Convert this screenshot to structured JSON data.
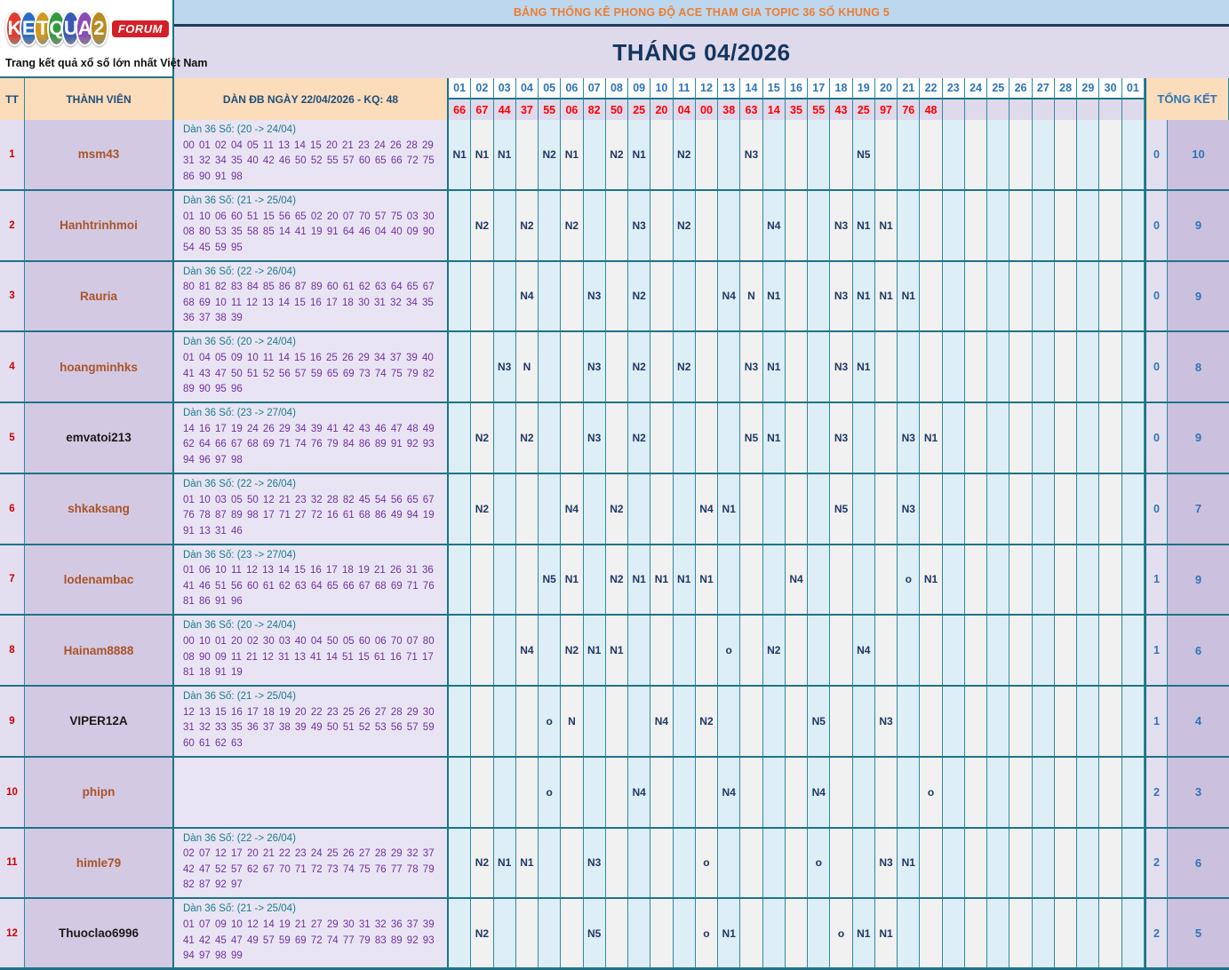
{
  "colors": {
    "border_teal": "#1d7488",
    "banner_bg": "#bdd7ee",
    "banner_text": "#ed7d31",
    "title_bg": "#dedaeb",
    "title_text": "#15355e",
    "header_peach": "#fbdcbb",
    "day_header_text": "#2e75b6",
    "result_text": "#ff0000",
    "value_text": "#1f3864",
    "dan_number_text": "#7030a0",
    "member_brown": "#a8552a",
    "member_black": "#1a1a1a"
  },
  "logo": {
    "letters": [
      {
        "ch": "K",
        "color": "#e23b2e"
      },
      {
        "ch": "E",
        "color": "#2a6bc8"
      },
      {
        "ch": "T",
        "color": "#d09a20"
      },
      {
        "ch": "Q",
        "color": "#319c3e"
      },
      {
        "ch": "U",
        "color": "#3a57b5"
      },
      {
        "ch": "A",
        "color": "#8a4bb8"
      },
      {
        "ch": "2",
        "color": "#b98a1e"
      }
    ],
    "forum_badge": "FORUM",
    "tagline": "Trang kết quả xổ số lớn nhất Việt Nam"
  },
  "banner": "BẢNG THỐNG KÊ PHONG ĐỘ ACE THAM GIA TOPIC 36 SỐ KHUNG 5",
  "title": "THÁNG 04/2026",
  "columns": {
    "tt": "TT",
    "member": "THÀNH VIÊN",
    "dan": "DÀN ĐB NGÀY 22/04/2026 - KQ: 48",
    "total": "TỔNG KẾT"
  },
  "days": [
    "01",
    "02",
    "03",
    "04",
    "05",
    "06",
    "07",
    "08",
    "09",
    "10",
    "11",
    "12",
    "13",
    "14",
    "15",
    "16",
    "17",
    "18",
    "19",
    "20",
    "21",
    "22",
    "23",
    "24",
    "25",
    "26",
    "27",
    "28",
    "29",
    "30",
    "01"
  ],
  "results": [
    "66",
    "67",
    "44",
    "37",
    "55",
    "06",
    "82",
    "50",
    "25",
    "20",
    "04",
    "00",
    "38",
    "63",
    "14",
    "35",
    "55",
    "43",
    "25",
    "97",
    "76",
    "48",
    "",
    "",
    "",
    "",
    "",
    "",
    "",
    "",
    ""
  ],
  "rows": [
    {
      "tt": "1",
      "member": "msm43",
      "member_color": "#a8552a",
      "dan_label": "Dàn 36 Số: (20 -> 24/04)",
      "dan_numbers": "00 01 02 04 05 11 13 14 15 20 21 23 24 26 28 29 31 32 34 35 40 42 46 50 52 55 57 60 65 66 72 75 86 90 91 98",
      "cells": {
        "1": "N1",
        "2": "N1",
        "3": "N1",
        "5": "N2",
        "6": "N1",
        "8": "N2",
        "9": "N1",
        "11": "N2",
        "14": "N3",
        "19": "N5"
      },
      "total1": "0",
      "total2": "10"
    },
    {
      "tt": "2",
      "member": "Hanhtrinhmoi",
      "member_color": "#a8552a",
      "dan_label": "Dàn 36 Số: (21 -> 25/04)",
      "dan_numbers": "01 10 06 60 51 15 56 65 02 20 07 70 57 75 03 30 08 80 53 35 58 85 14 41 19 91 64 46 04 40 09 90 54 45 59 95",
      "cells": {
        "2": "N2",
        "4": "N2",
        "6": "N2",
        "9": "N3",
        "11": "N2",
        "15": "N4",
        "18": "N3",
        "19": "N1",
        "20": "N1"
      },
      "total1": "0",
      "total2": "9"
    },
    {
      "tt": "3",
      "member": "Rauria",
      "member_color": "#a8552a",
      "dan_label": "Dàn 36 Số: (22 -> 26/04)",
      "dan_numbers": "80 81 82 83 84 85 86 87 89 60 61 62 63 64 65 67 68 69 10 11 12 13 14 15 16 17 18 30 31 32 34 35 36 37 38 39",
      "cells": {
        "4": "N4",
        "7": "N3",
        "9": "N2",
        "13": "N4",
        "14": "N",
        "15": "N1",
        "18": "N3",
        "19": "N1",
        "20": "N1",
        "21": "N1"
      },
      "total1": "0",
      "total2": "9"
    },
    {
      "tt": "4",
      "member": "hoangminhks",
      "member_color": "#a8552a",
      "dan_label": "Dàn 36 Số: (20 -> 24/04)",
      "dan_numbers": "01 04 05 09 10 11 14 15 16 25 26 29 34 37 39 40 41 43 47 50 51 52 56 57 59 65 69 73 74 75 79 82 89 90 95 96",
      "cells": {
        "3": "N3",
        "4": "N",
        "7": "N3",
        "9": "N2",
        "11": "N2",
        "14": "N3",
        "15": "N1",
        "18": "N3",
        "19": "N1"
      },
      "total1": "0",
      "total2": "8"
    },
    {
      "tt": "5",
      "member": "emvatoi213",
      "member_color": "#1a1a1a",
      "dan_label": "Dàn 36 Số: (23 -> 27/04)",
      "dan_numbers": "14 16 17 19 24 26 29 34 39 41 42 43 46 47 48 49 62 64 66 67 68 69 71 74 76 79 84 86 89 91 92 93 94 96 97 98",
      "cells": {
        "2": "N2",
        "4": "N2",
        "7": "N3",
        "9": "N2",
        "14": "N5",
        "15": "N1",
        "18": "N3",
        "21": "N3",
        "22": "N1"
      },
      "total1": "0",
      "total2": "9"
    },
    {
      "tt": "6",
      "member": "shkaksang",
      "member_color": "#a8552a",
      "dan_label": "Dàn 36 Số: (22 -> 26/04)",
      "dan_numbers": "01 10 03 05 50 12 21 23 32 28 82 45 54 56 65 67 76 78 87 89 98 17 71 27 72 16 61 68 86 49 94 19 91 13 31 46",
      "cells": {
        "2": "N2",
        "6": "N4",
        "8": "N2",
        "12": "N4",
        "13": "N1",
        "18": "N5",
        "21": "N3"
      },
      "total1": "0",
      "total2": "7"
    },
    {
      "tt": "7",
      "member": "lodenambac",
      "member_color": "#a8552a",
      "dan_label": "Dàn 36 Số: (23 -> 27/04)",
      "dan_numbers": "01 06 10 11 12 13 14 15 16 17 18 19 21 26 31 36 41 46 51 56 60 61 62 63 64 65 66 67 68 69 71 76 81 86 91 96",
      "cells": {
        "5": "N5",
        "6": "N1",
        "8": "N2",
        "9": "N1",
        "10": "N1",
        "11": "N1",
        "12": "N1",
        "16": "N4",
        "21": "o",
        "22": "N1"
      },
      "total1": "1",
      "total2": "9"
    },
    {
      "tt": "8",
      "member": "Hainam8888",
      "member_color": "#a8552a",
      "dan_label": "Dàn 36 Số: (20 -> 24/04)",
      "dan_numbers": "00 10 01 20 02 30 03 40 04 50 05 60 06 70 07 80 08 90 09 11 21 12 31 13 41 14 51 15 61 16 71 17 81 18 91 19",
      "cells": {
        "4": "N4",
        "6": "N2",
        "7": "N1",
        "8": "N1",
        "13": "o",
        "15": "N2",
        "19": "N4"
      },
      "total1": "1",
      "total2": "6"
    },
    {
      "tt": "9",
      "member": "VIPER12A",
      "member_color": "#1a1a1a",
      "dan_label": "Dàn 36 Số: (21 -> 25/04)",
      "dan_numbers": "12 13 15 16 17 18 19 20 22 23 25 26 27 28 29 30 31 32 33 35 36 37 38 39 49 50 51 52 53 56 57 59 60 61 62 63",
      "cells": {
        "5": "o",
        "6": "N",
        "10": "N4",
        "12": "N2",
        "17": "N5",
        "20": "N3"
      },
      "total1": "1",
      "total2": "4"
    },
    {
      "tt": "10",
      "member": "phipn",
      "member_color": "#a8552a",
      "dan_label": "",
      "dan_numbers": "",
      "cells": {
        "5": "o",
        "9": "N4",
        "13": "N4",
        "17": "N4",
        "22": "o"
      },
      "total1": "2",
      "total2": "3"
    },
    {
      "tt": "11",
      "member": "himle79",
      "member_color": "#a8552a",
      "dan_label": "Dàn 36 Số: (22 -> 26/04)",
      "dan_numbers": "02 07 12 17 20 21 22 23 24 25 26 27 28 29 32 37 42 47 52 57 62 67 70 71 72 73 74 75 76 77 78 79 82 87 92 97",
      "cells": {
        "2": "N2",
        "3": "N1",
        "4": "N1",
        "7": "N3",
        "12": "o",
        "17": "o",
        "20": "N3",
        "21": "N1"
      },
      "total1": "2",
      "total2": "6"
    },
    {
      "tt": "12",
      "member": "Thuoclao6996",
      "member_color": "#1a1a1a",
      "dan_label": "Dàn 36 Số: (21 -> 25/04)",
      "dan_numbers": "01 07 09 10 12 14 19 21 27 29 30 31 32 36 37 39 41 42 45 47 49 57 59 69 72 74 77 79 83 89 92 93 94 97 98 99",
      "cells": {
        "2": "N2",
        "7": "N5",
        "12": "o",
        "13": "N1",
        "18": "o",
        "19": "N1",
        "20": "N1"
      },
      "total1": "2",
      "total2": "5"
    }
  ]
}
